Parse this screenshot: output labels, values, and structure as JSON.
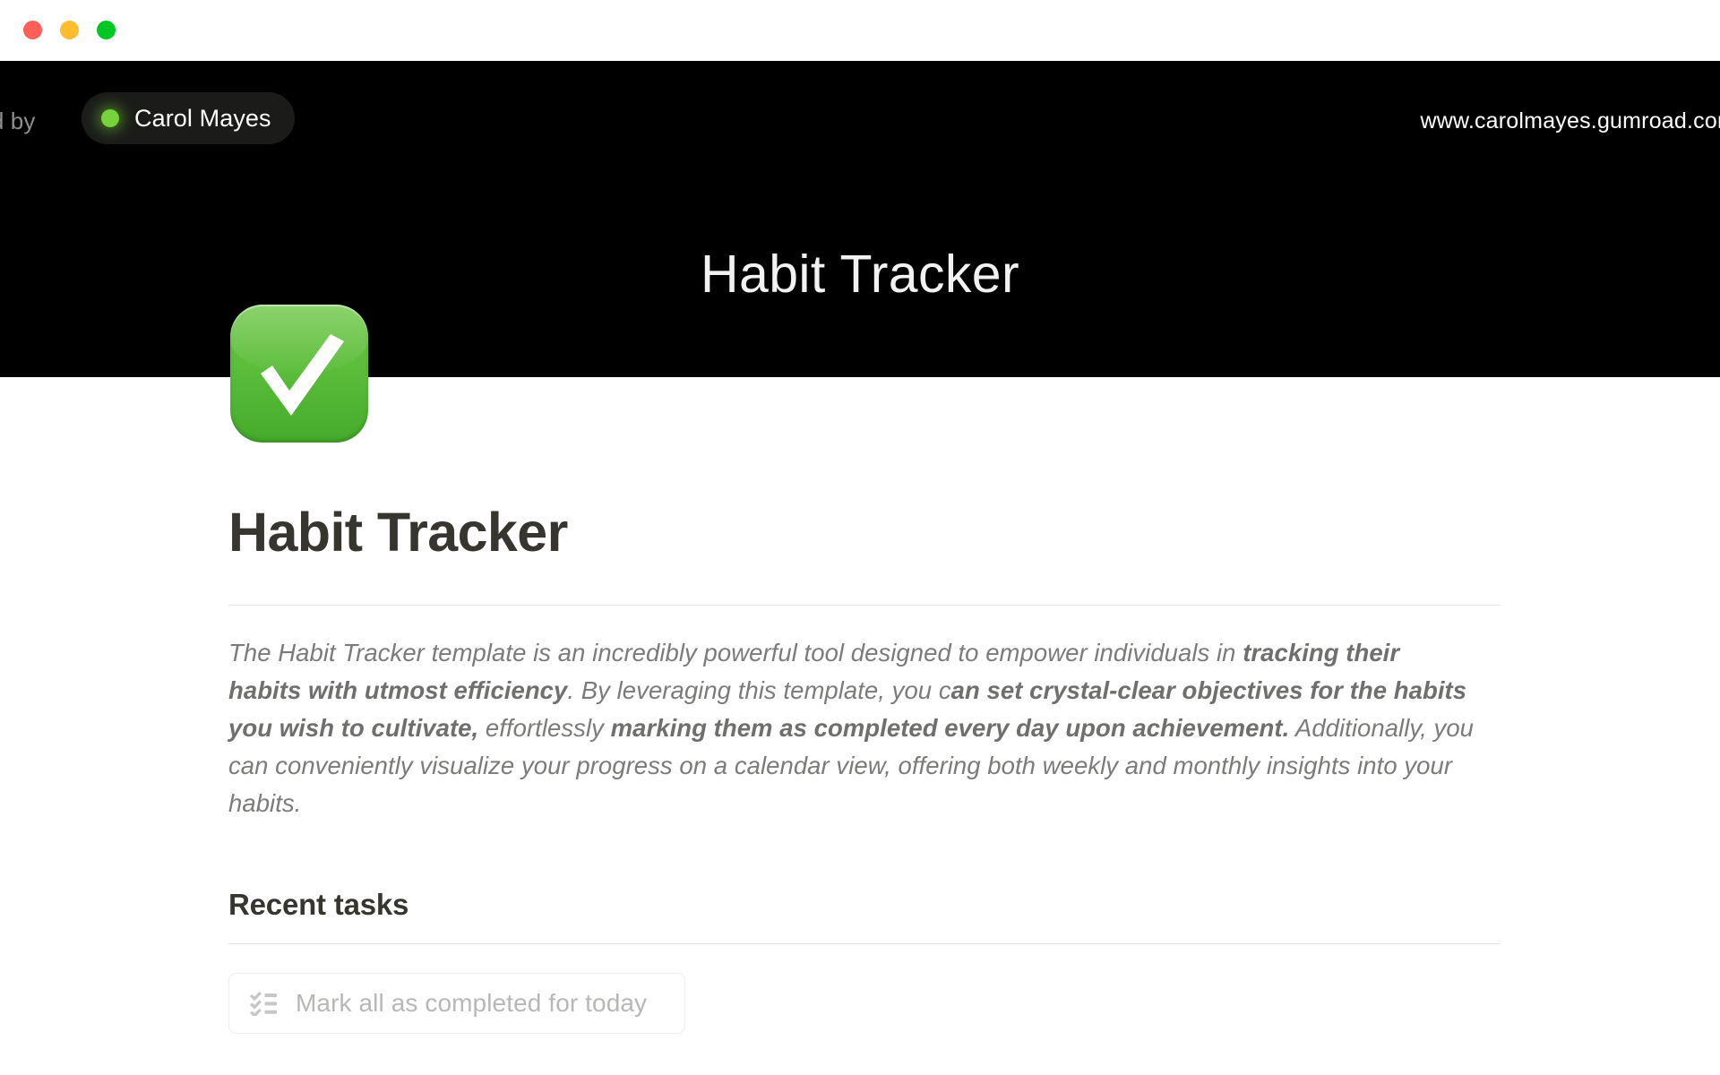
{
  "window": {
    "traffic_lights": [
      {
        "name": "close",
        "color": "#fe5f57"
      },
      {
        "name": "minimize",
        "color": "#febc2e"
      },
      {
        "name": "maximize",
        "color": "#00c721"
      }
    ]
  },
  "cover": {
    "background_color": "#000000",
    "created_by_label": "ted by",
    "author_name": "Carol Mayes",
    "author_status_color": "#76d339",
    "site_url": "www.carolmayes.gumroad.com",
    "title": "Habit Tracker"
  },
  "page": {
    "icon_name": "green-check-mark-emoji",
    "icon_color": "#5bbd3a",
    "title": "Habit Tracker",
    "paragraph": [
      {
        "text": "The Habit Tracker template is an incredibly powerful tool designed to empower individuals in ",
        "bold": false
      },
      {
        "text": "tracking their habits with utmost efficiency",
        "bold": true
      },
      {
        "text": ". By leveraging this template, you c",
        "bold": false
      },
      {
        "text": "an set crystal-clear objectives for the habits you wish to cultivate,",
        "bold": true
      },
      {
        "text": " effortlessly ",
        "bold": false
      },
      {
        "text": "marking them as completed every day upon achievement.",
        "bold": true
      },
      {
        "text": " Additionally, you can conveniently visualize your progress on a calendar view, offering both weekly and monthly insights into your habits.",
        "bold": false
      }
    ]
  },
  "recent_tasks": {
    "heading": "Recent tasks",
    "mark_all_button": {
      "label": "Mark all as completed for today",
      "icon_name": "checklist-icon"
    }
  }
}
